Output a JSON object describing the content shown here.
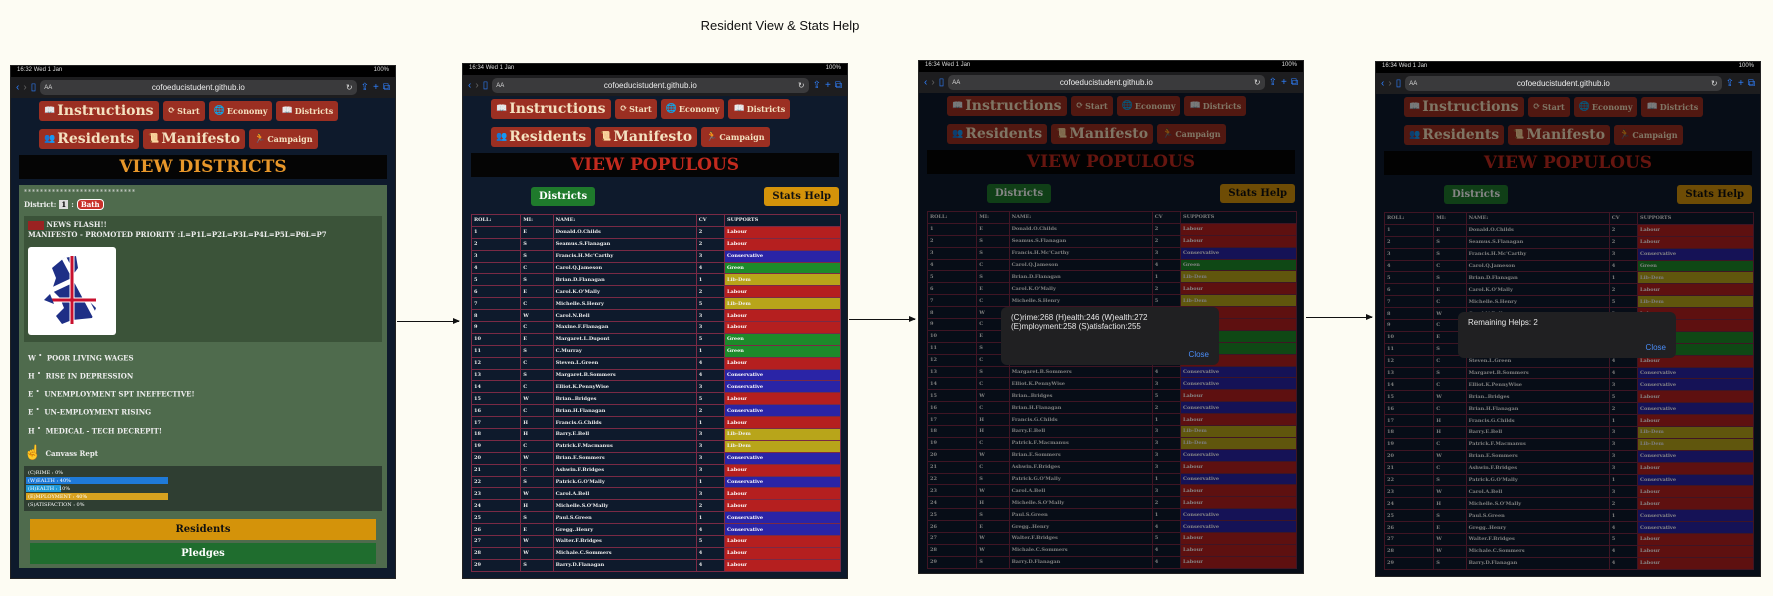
{
  "title": "Resident View & Stats Help",
  "url": "cofoeducistudent.github.io",
  "aa": "AA",
  "nav": [
    "Instructions",
    "Start",
    "Economy",
    "Districts",
    "Residents",
    "Manifesto",
    "Campaign"
  ],
  "phones": [
    {
      "time": "16:32",
      "date": "Wed 1 Jan",
      "battery": "100%"
    },
    {
      "time": "16:34",
      "date": "Wed 1 Jan",
      "battery": "100%"
    },
    {
      "time": "16:34",
      "date": "Wed 1 Jan",
      "battery": "100%"
    },
    {
      "time": "16:34",
      "date": "Wed 1 Jan",
      "battery": "100%"
    }
  ],
  "districts": {
    "heading": "VIEW DISTRICTS",
    "dots": "****************************",
    "district_label": "District:",
    "district_value": "1",
    "colon": ":",
    "district_name": "Bath",
    "news": "NEWS FLASH!!",
    "manifesto": "MANIFESTO - PROMOTED PRIORITY :L=P1L=P2L=P3L=P4L=P5L=P6L=P7",
    "tweets": [
      {
        "k": "W",
        "t": "POOR LIVING WAGES"
      },
      {
        "k": "H",
        "t": "RISE IN DEPRESSION"
      },
      {
        "k": "E",
        "t": "UNEMPLOYMENT SPT INEFFECTIVE!"
      },
      {
        "k": "E",
        "t": "UN-EMPLOYMENT RISING"
      },
      {
        "k": "H",
        "t": "MEDICAL - TECH DECREPIT!"
      }
    ],
    "canvass": "Canvass Rept",
    "stats": [
      {
        "label": "(C)RIME : 0%",
        "value": 0,
        "color": "#3b6ea0"
      },
      {
        "label": "(W)EALTH : 40%",
        "value": 40,
        "color": "#1f7ad8"
      },
      {
        "label": "(H)EALTH : 10%",
        "value": 10,
        "color": "#1f9ad8"
      },
      {
        "label": "(E)MPLOYMENT : 40%",
        "value": 40,
        "color": "#d8a21f"
      },
      {
        "label": "(S)ATISFACTION : 0%",
        "value": 0,
        "color": "#3b6ea0"
      }
    ],
    "residents_btn": "Residents",
    "pledges_btn": "Pledges"
  },
  "populous": {
    "heading": "VIEW POPULOUS",
    "districts_btn": "Districts",
    "stats_btn": "Stats Help",
    "headers": [
      "ROLL:",
      "MI:",
      "NAME:",
      "CV",
      "SUPPORTS"
    ]
  },
  "rows": [
    [
      "1",
      "E",
      "Donald.O.Childs",
      "2",
      "Labour"
    ],
    [
      "2",
      "S",
      "Seamus.S.Flanagan",
      "2",
      "Labour"
    ],
    [
      "3",
      "S",
      "Francis.H.Mc'Carthy",
      "3",
      "Conservative"
    ],
    [
      "4",
      "C",
      "Carol.Q.Jameson",
      "4",
      "Green"
    ],
    [
      "5",
      "S",
      "Brian.D.Flanagan",
      "1",
      "Lib-Dem"
    ],
    [
      "6",
      "E",
      "Carol.K.O'Mally",
      "2",
      "Labour"
    ],
    [
      "7",
      "C",
      "Michelle.S.Henry",
      "5",
      "Lib-Dem"
    ],
    [
      "8",
      "W",
      "Carol.N.Bell",
      "3",
      "Labour"
    ],
    [
      "9",
      "C",
      "Maxine.F.Flanagan",
      "3",
      "Labour"
    ],
    [
      "10",
      "E",
      "Margaret.L.Dupont",
      "5",
      "Green"
    ],
    [
      "11",
      "S",
      "C.Murray",
      "1",
      "Green"
    ],
    [
      "12",
      "C",
      "Steven.L.Green",
      "4",
      "Labour"
    ],
    [
      "13",
      "S",
      "Margaret.B.Sommers",
      "4",
      "Conservative"
    ],
    [
      "14",
      "C",
      "Elliot.K.PennyWise",
      "3",
      "Conservative"
    ],
    [
      "15",
      "W",
      "Brian..Bridges",
      "5",
      "Labour"
    ],
    [
      "16",
      "C",
      "Brian.H.Flanagan",
      "2",
      "Conservative"
    ],
    [
      "17",
      "H",
      "Francis.G.Childs",
      "1",
      "Labour"
    ],
    [
      "18",
      "H",
      "Barry.E.Bell",
      "3",
      "Lib-Dem"
    ],
    [
      "19",
      "C",
      "Patrick.F.Macmanus",
      "3",
      "Lib-Dem"
    ],
    [
      "20",
      "W",
      "Brian.E.Sommers",
      "3",
      "Conservative"
    ],
    [
      "21",
      "C",
      "Ashwin.F.Bridges",
      "3",
      "Labour"
    ],
    [
      "22",
      "S",
      "Patrick.G.O'Mally",
      "1",
      "Conservative"
    ],
    [
      "23",
      "W",
      "Carol.A.Bell",
      "3",
      "Labour"
    ],
    [
      "24",
      "H",
      "Michelle.S.O'Mally",
      "2",
      "Labour"
    ],
    [
      "25",
      "S",
      "Paul.S.Green",
      "1",
      "Conservative"
    ],
    [
      "26",
      "E",
      "Gregg..Henry",
      "4",
      "Conservative"
    ],
    [
      "27",
      "W",
      "Walter.F.Bridges",
      "5",
      "Labour"
    ],
    [
      "28",
      "W",
      "Michale.C.Sommers",
      "4",
      "Labour"
    ],
    [
      "29",
      "S",
      "Barry.D.Flanagan",
      "4",
      "Labour"
    ]
  ],
  "party_colors": {
    "Labour": "#b51f1f",
    "Conservative": "#2a24a6",
    "Green": "#1d8a2a",
    "Lib-Dem": "#b8a51a"
  },
  "popup1": {
    "line1": "(C)rime:268 (H)ealth:246 (W)ealth:272",
    "line2": "(E)mployment:258 (S)atisfaction:255",
    "close": "Close"
  },
  "popup2": {
    "line1": "Remaining Helps:  2",
    "close": "Close"
  }
}
